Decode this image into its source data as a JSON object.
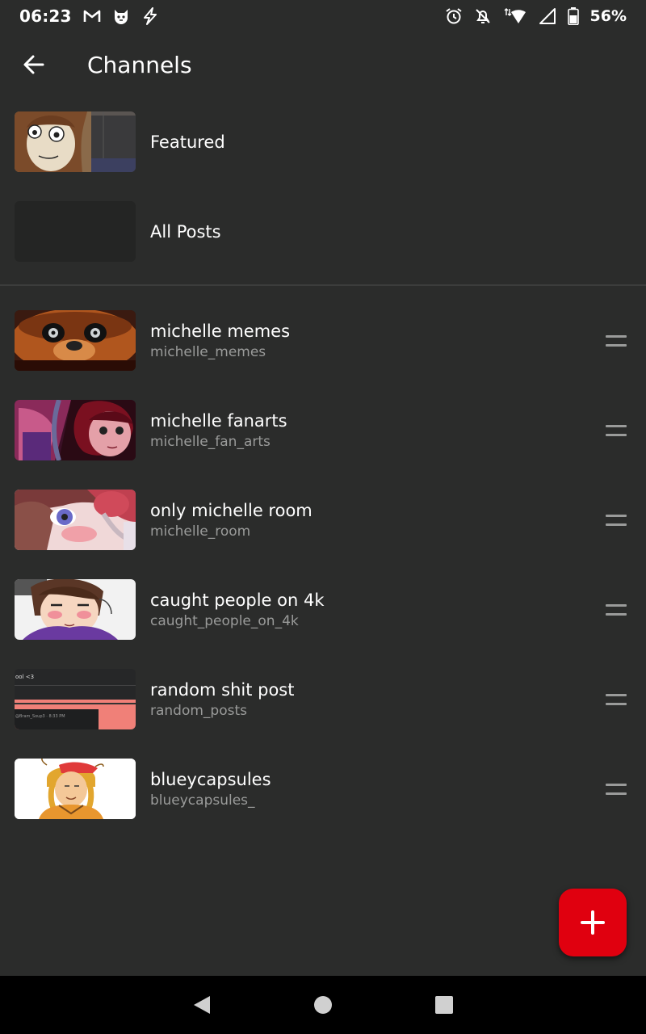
{
  "status_bar": {
    "time": "06:23",
    "left_icons": [
      "gmail-icon",
      "cat-app-icon",
      "lightning-icon"
    ],
    "right_icons": [
      "alarm-icon",
      "notifications-off-icon",
      "wifi-icon",
      "signal-icon",
      "battery-icon"
    ],
    "battery_percent": "56%"
  },
  "app_bar": {
    "back_icon": "arrow-left-icon",
    "title": "Channels"
  },
  "fixed_items": [
    {
      "title": "Featured"
    },
    {
      "title": "All Posts"
    }
  ],
  "channels": [
    {
      "title": "michelle memes",
      "handle": "michelle_memes"
    },
    {
      "title": "michelle fanarts",
      "handle": "michelle_fan_arts"
    },
    {
      "title": "only michelle room",
      "handle": "michelle_room"
    },
    {
      "title": "caught people on 4k",
      "handle": "caught_people_on_4k"
    },
    {
      "title": "random shit post",
      "handle": "random_posts"
    },
    {
      "title": "blueycapsules",
      "handle": "blueycapsules_"
    }
  ],
  "thumb_texts": {
    "random_top": "ool <3",
    "random_bottom": "@Bram_Soup3 · 8:33 PM"
  },
  "fab": {
    "icon": "plus-icon",
    "color": "#e0000f"
  },
  "nav_bar": {
    "buttons": [
      "back-triangle-icon",
      "home-circle-icon",
      "recents-square-icon"
    ]
  },
  "colors": {
    "background": "#2b2c2b",
    "text_primary": "#ffffff",
    "text_secondary": "#9a9b9a",
    "accent": "#e0000f"
  }
}
